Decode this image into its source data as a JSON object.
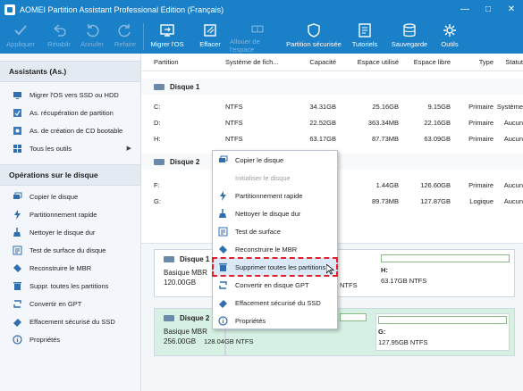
{
  "window": {
    "title": "AOMEI Partition Assistant Professional Edition (Français)",
    "controls": [
      "—",
      "□",
      "✕"
    ]
  },
  "toolbar": {
    "items": [
      {
        "label": "Appliquer",
        "icon": "check-icon",
        "disabled": true
      },
      {
        "label": "Rétablir",
        "icon": "undo-icon",
        "disabled": true
      },
      {
        "label": "Annuler",
        "icon": "undo-arrow-icon",
        "disabled": true
      },
      {
        "label": "Refaire",
        "icon": "redo-icon",
        "disabled": true
      },
      {
        "label": "Migrer l'OS",
        "icon": "migrate-os-icon",
        "disabled": false
      },
      {
        "label": "Effacer",
        "icon": "wipe-icon",
        "disabled": false
      },
      {
        "label": "Allouer de l'espace",
        "icon": "allocate-icon",
        "disabled": true
      },
      {
        "label": "Partition sécurisée",
        "icon": "shield-icon",
        "disabled": false
      },
      {
        "label": "Tutoriels",
        "icon": "book-icon",
        "disabled": false
      },
      {
        "label": "Sauvegarde",
        "icon": "backup-icon",
        "disabled": false
      },
      {
        "label": "Outils",
        "icon": "tools-icon",
        "disabled": false
      }
    ]
  },
  "sidebar": {
    "wizards_title": "Assistants (As.)",
    "wizards": [
      {
        "label": "Migrer l'OS vers SSD ou HDD",
        "icon": "migrate-icon"
      },
      {
        "label": "As. récupération de partition",
        "icon": "recovery-icon"
      },
      {
        "label": "As. de création de CD bootable",
        "icon": "cd-icon"
      },
      {
        "label": "Tous les outils",
        "icon": "grid-icon",
        "arrow": "▶"
      }
    ],
    "ops_title": "Opérations sur le disque",
    "ops": [
      {
        "label": "Copier le disque",
        "icon": "copy-disk-icon"
      },
      {
        "label": "Partitionnement rapide",
        "icon": "lightning-icon"
      },
      {
        "label": "Nettoyer le disque dur",
        "icon": "broom-icon"
      },
      {
        "label": "Test de surface du disque",
        "icon": "surface-test-icon"
      },
      {
        "label": "Reconstruire le MBR",
        "icon": "mbr-icon"
      },
      {
        "label": "Suppr. toutes les partitions",
        "icon": "trash-icon"
      },
      {
        "label": "Convertir en GPT",
        "icon": "convert-icon"
      },
      {
        "label": "Effacement sécurisé du SSD",
        "icon": "eraser-icon"
      },
      {
        "label": "Propriétés",
        "icon": "info-icon"
      }
    ]
  },
  "table": {
    "headers": [
      "Partition",
      "Système de fich...",
      "Capacité",
      "Espace utilisé",
      "Espace libre",
      "Type",
      "Statut"
    ],
    "disk1_label": "Disque 1",
    "disk1_rows": [
      [
        "C:",
        "NTFS",
        "34.31GB",
        "25.16GB",
        "9.15GB",
        "Primaire",
        "Système"
      ],
      [
        "D:",
        "NTFS",
        "22.52GB",
        "363.34MB",
        "22.16GB",
        "Primaire",
        "Aucun"
      ],
      [
        "H:",
        "NTFS",
        "63.17GB",
        "87.73MB",
        "63.09GB",
        "Primaire",
        "Aucun"
      ]
    ],
    "disk2_label": "Disque 2",
    "disk2_rows": [
      [
        "F:",
        "",
        "",
        "1.44GB",
        "126.60GB",
        "Primaire",
        "Aucun"
      ],
      [
        "G:",
        "",
        "",
        "89.73MB",
        "127.87GB",
        "Logique",
        "Aucun"
      ]
    ]
  },
  "diskmap": {
    "disk1": {
      "name": "Disque 1",
      "type": "Basique MBR",
      "size": "120.00GB"
    },
    "disk1_partitions": [
      {
        "letter": "",
        "detail": "NTFS"
      },
      {
        "letter": "H:",
        "detail": "63.17GB NTFS"
      }
    ],
    "disk2": {
      "name": "Disque 2",
      "type": "Basique MBR",
      "size": "256.00GB"
    },
    "disk2_partitions": [
      {
        "letter": "",
        "detail": "128.04GB NTFS"
      },
      {
        "letter": "G:",
        "detail": "127.95GB NTFS"
      }
    ]
  },
  "context_menu": {
    "items": [
      {
        "label": "Copier le disque",
        "icon": "copy-disk-icon",
        "disabled": false
      },
      {
        "label": "Initialiser le disque",
        "icon": "",
        "disabled": true
      },
      {
        "label": "Partitionnement rapide",
        "icon": "lightning-icon",
        "disabled": false
      },
      {
        "label": "Nettoyer le disque dur",
        "icon": "broom-icon",
        "disabled": false
      },
      {
        "label": "Test de surface",
        "icon": "surface-test-icon",
        "disabled": false
      },
      {
        "label": "Reconstruire le MBR",
        "icon": "mbr-icon",
        "disabled": false
      },
      {
        "label": "Supprimer toutes les partitions",
        "icon": "trash-icon",
        "disabled": false,
        "highlight": true
      },
      {
        "label": "Convertir en disque GPT",
        "icon": "convert-icon",
        "disabled": false
      },
      {
        "label": "Effacement sécurisé du SSD",
        "icon": "eraser-icon",
        "disabled": false
      },
      {
        "label": "Propriétés",
        "icon": "info-icon",
        "disabled": false
      }
    ]
  },
  "colors": {
    "accent": "#1a80c8",
    "highlight_border": "#e0202a",
    "disk2_selected": "#d6f0e4"
  }
}
